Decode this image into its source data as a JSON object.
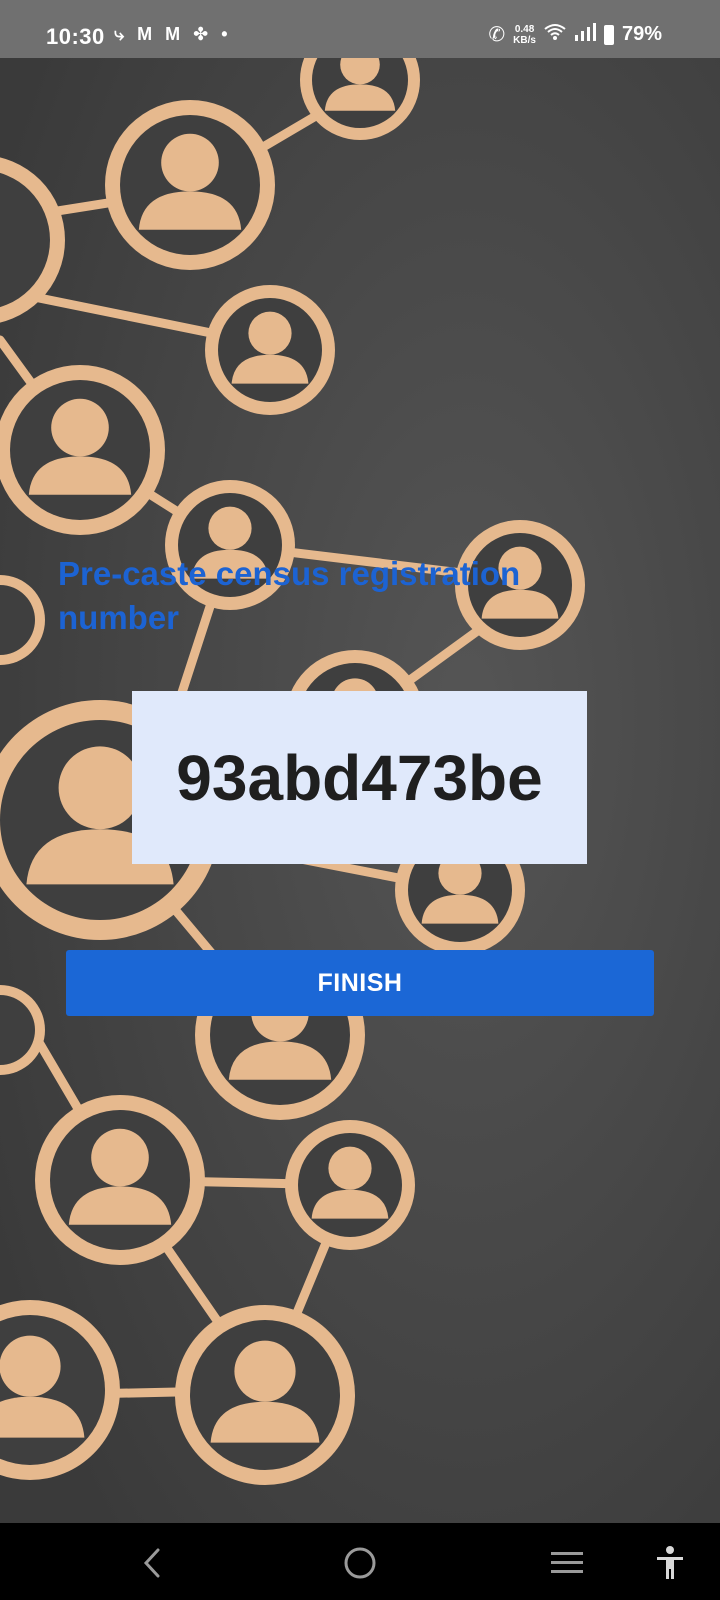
{
  "status_bar": {
    "time": "10:30",
    "net_speed_value": "0.48",
    "net_speed_unit": "KB/s",
    "battery": "79%",
    "icons": [
      "missed-call-icon",
      "gmail-icon",
      "gmail-icon",
      "pinwheel-icon",
      "dot-icon",
      "wifi-call-icon",
      "wifi-icon",
      "signal-icon",
      "battery-icon"
    ]
  },
  "main": {
    "title": "Pre-caste census registration number",
    "registration_number": "93abd473be",
    "finish_label": "FINISH"
  },
  "nav_bar": {
    "icons": [
      "back-icon",
      "home-icon",
      "recents-icon",
      "accessibility-icon"
    ]
  },
  "colors": {
    "title": "#1c63d3",
    "button": "#1b67d6",
    "number_box": "#e0e9fb",
    "background": "#4a4a4a",
    "wood": "#e6b98e"
  }
}
